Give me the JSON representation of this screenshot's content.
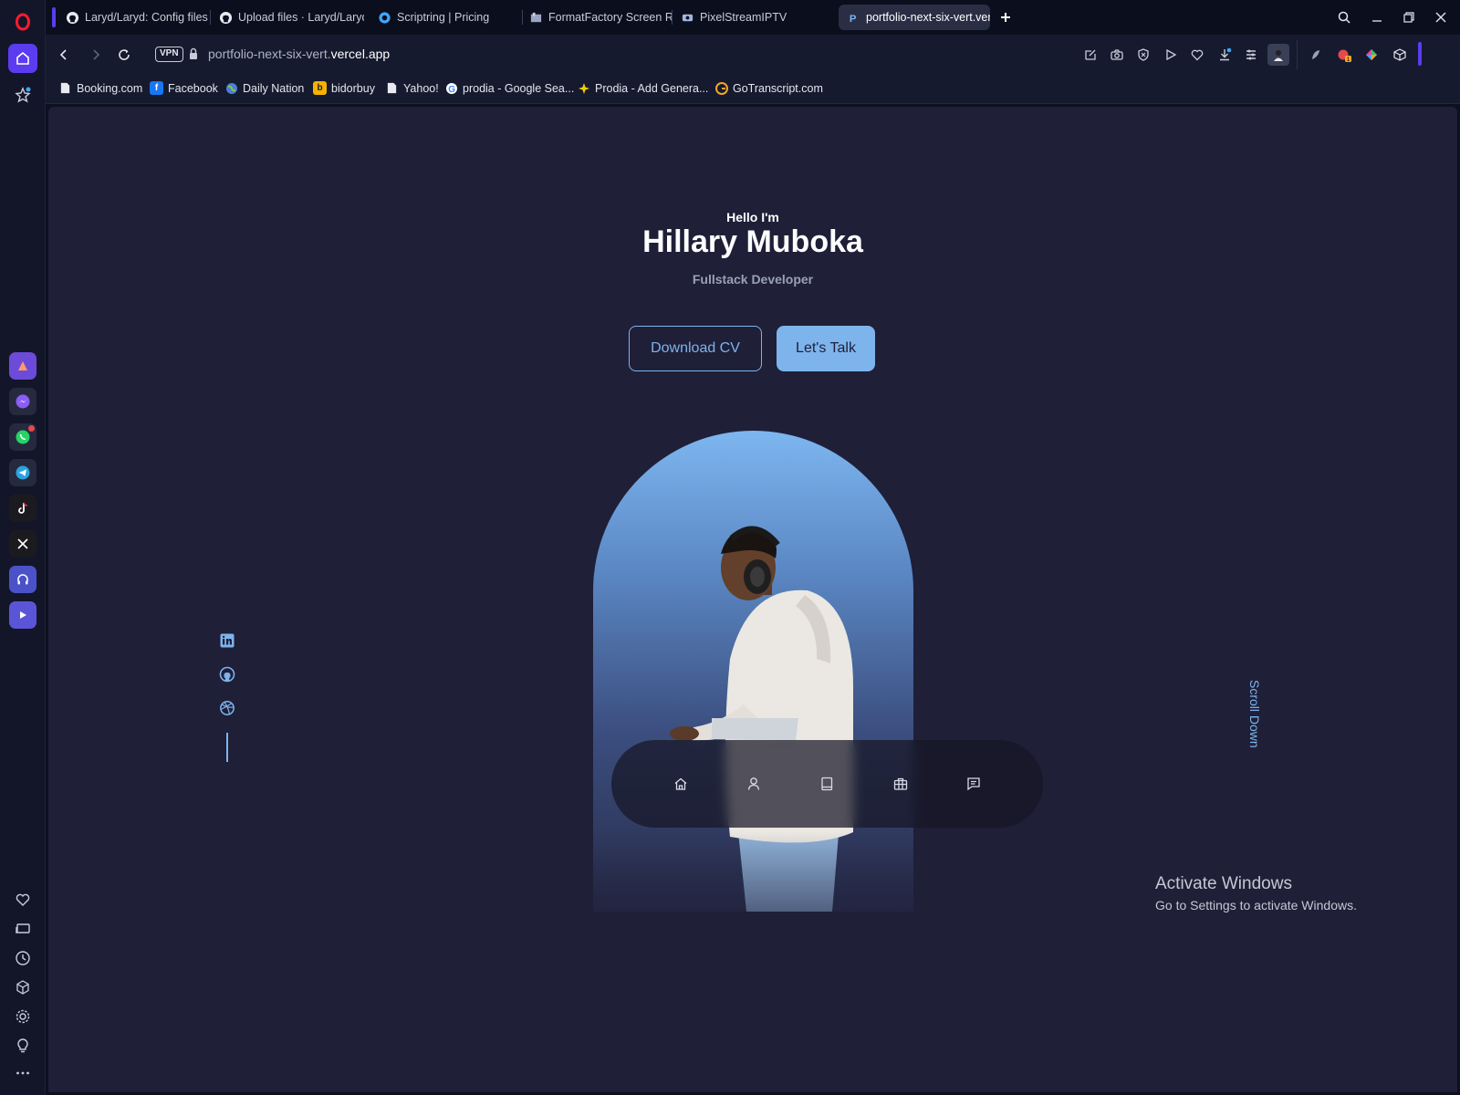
{
  "browser": {
    "tabs": [
      {
        "label": "Laryd/Laryd: Config files fo",
        "icon": "github-icon"
      },
      {
        "label": "Upload files · Laryd/Laryd",
        "icon": "github-icon"
      },
      {
        "label": "Scriptring | Pricing",
        "icon": "scriptring-icon"
      },
      {
        "label": "FormatFactory Screen Rec",
        "icon": "formatfactory-icon"
      },
      {
        "label": "PixelStreamIPTV",
        "icon": "pixelstream-icon"
      },
      {
        "label": "portfolio-next-six-vert.verc",
        "icon": "portfolio-icon",
        "active": true
      }
    ],
    "address": {
      "vpn_label": "VPN",
      "url_prefix": "portfolio-next-six-vert.",
      "url_domain": "vercel.app"
    },
    "bookmarks": [
      {
        "label": "Booking.com"
      },
      {
        "label": "Facebook"
      },
      {
        "label": "Daily Nation"
      },
      {
        "label": "bidorbuy"
      },
      {
        "label": "Yahoo!"
      },
      {
        "label": "prodia - Google Sea..."
      },
      {
        "label": "Prodia - Add Genera..."
      },
      {
        "label": "GoTranscript.com"
      }
    ],
    "extension_badge": "1"
  },
  "page": {
    "hello": "Hello I'm",
    "name": "Hillary Muboka",
    "role": "Fullstack Developer",
    "download_cv": "Download CV",
    "lets_talk": "Let's Talk",
    "scroll_down": "Scroll Down",
    "socials": [
      "linkedin-icon",
      "github-icon",
      "dribbble-icon"
    ],
    "dock": [
      "home-icon",
      "user-icon",
      "book-icon",
      "briefcase-icon",
      "message-icon"
    ],
    "accent_color": "#7db4ec",
    "background_color": "#1f1f38"
  },
  "os": {
    "activate_title": "Activate Windows",
    "activate_sub": "Go to Settings to activate Windows."
  }
}
